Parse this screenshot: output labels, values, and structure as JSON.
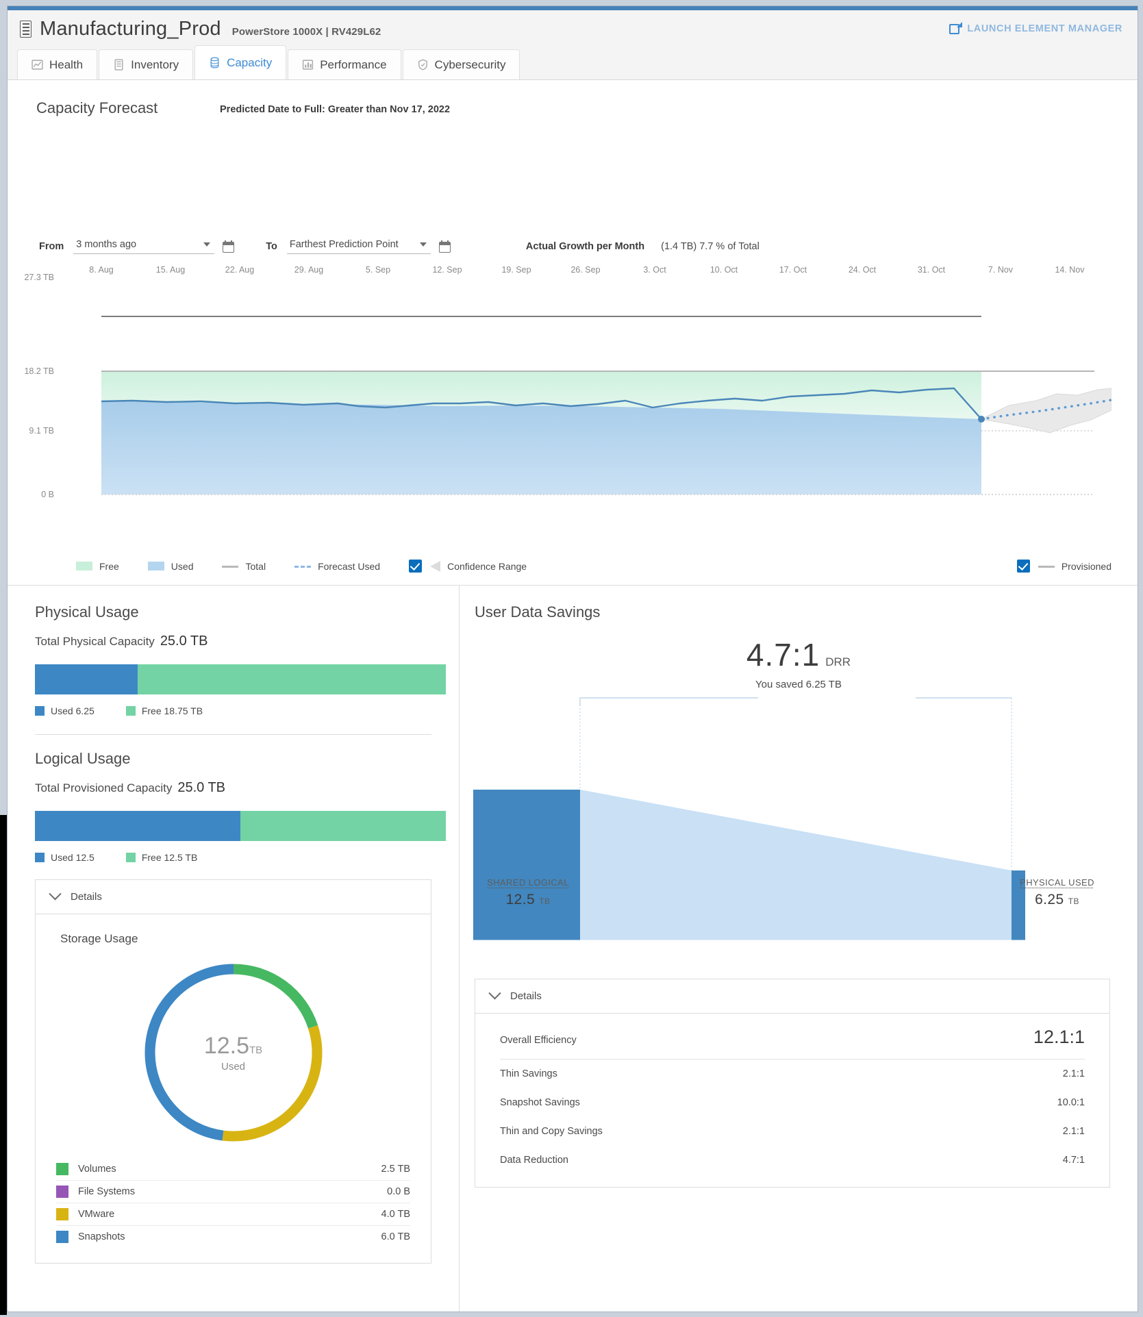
{
  "header": {
    "system_name": "Manufacturing_Prod",
    "system_model": "PowerStore 1000X | RV429L62",
    "launch_label": "LAUNCH ELEMENT MANAGER",
    "system_icon": "storage-array-icon",
    "launch_icon": "external-link-icon"
  },
  "tabs": [
    {
      "label": "Health",
      "icon": "health-chart-icon",
      "active": false
    },
    {
      "label": "Inventory",
      "icon": "inventory-rack-icon",
      "active": false
    },
    {
      "label": "Capacity",
      "icon": "capacity-database-icon",
      "active": true
    },
    {
      "label": "Performance",
      "icon": "performance-bars-icon",
      "active": false
    },
    {
      "label": "Cybersecurity",
      "icon": "shield-icon",
      "active": false
    }
  ],
  "forecast": {
    "title": "Capacity Forecast",
    "predicted": "Predicted Date to Full: Greater than Nov 17, 2022",
    "from_label": "From",
    "from_value": "3 months ago",
    "to_label": "To",
    "to_value": "Farthest Prediction Point",
    "growth_label": "Actual Growth per Month",
    "growth_value": "(1.4 TB) 7.7 % of Total",
    "legend": [
      {
        "label": "Free",
        "type": "swatch-free"
      },
      {
        "label": "Used",
        "type": "swatch-used"
      },
      {
        "label": "Total",
        "type": "line-total"
      },
      {
        "label": "Forecast Used",
        "type": "line-forecast"
      },
      {
        "label": "Confidence Range",
        "type": "checkbox-area",
        "checked": true
      }
    ],
    "legend_right": {
      "label": "Provisioned",
      "checked": true
    }
  },
  "chart_data": {
    "type": "area",
    "title": "Capacity Forecast",
    "xlabel": "",
    "ylabel": "",
    "grid": true,
    "legend_position": "bottom",
    "ylim": [
      0,
      27.3
    ],
    "yunit": "TB",
    "ytick_labels": [
      "27.3 TB",
      "18.2 TB",
      "9.1 TB",
      "0 B"
    ],
    "ytick_values": [
      27.3,
      18.2,
      9.1,
      0
    ],
    "xtick_labels": [
      "8. Aug",
      "15. Aug",
      "22. Aug",
      "29. Aug",
      "5. Sep",
      "12. Sep",
      "19. Sep",
      "26. Sep",
      "3. Oct",
      "10. Oct",
      "17. Oct",
      "24. Oct",
      "31. Oct",
      "7. Nov",
      "14. Nov"
    ],
    "series": [
      {
        "name": "Total",
        "type": "line",
        "color": "#9a9a9a",
        "values": [
          25.0,
          25.0,
          25.0,
          25.0,
          25.0,
          25.0,
          25.0,
          25.0,
          25.0,
          25.0,
          25.0,
          25.0,
          25.0
        ]
      },
      {
        "name": "Provisioned",
        "type": "line",
        "color": "#9a9a9a",
        "values": [
          18.2,
          18.2,
          18.2,
          18.2,
          18.2,
          18.2,
          18.2,
          18.2,
          18.2,
          18.2,
          18.2,
          18.2,
          18.2
        ]
      },
      {
        "name": "Free",
        "type": "area",
        "color": "#c8efd9",
        "values": [
          9.2,
          9.1,
          9.1,
          9.0,
          9.0,
          9.0,
          8.9,
          8.8,
          8.6,
          8.5,
          8.4,
          8.2,
          8.0
        ]
      },
      {
        "name": "Used",
        "type": "area",
        "color": "#aed0ea",
        "values": [
          8.9,
          9.0,
          9.0,
          9.1,
          9.1,
          9.1,
          9.3,
          9.4,
          9.6,
          9.7,
          9.8,
          10.0,
          10.2
        ]
      },
      {
        "name": "Forecast Used",
        "type": "dotted-line",
        "color": "#5b9bd5",
        "values": [
          10.2,
          10.5,
          10.8,
          11.1,
          11.4,
          11.7
        ]
      },
      {
        "name": "Confidence Range",
        "type": "band",
        "color": "#e6e6e6",
        "lower": [
          10.2,
          10.0,
          10.1,
          9.9,
          10.3,
          10.4
        ],
        "upper": [
          10.2,
          11.0,
          11.6,
          11.9,
          12.6,
          13.1
        ]
      }
    ]
  },
  "physical_usage": {
    "title": "Physical Usage",
    "total_label": "Total Physical Capacity",
    "total_value": "25.0 TB",
    "used_label": "Used 6.25",
    "free_label": "Free 18.75 TB",
    "used_pct": 25,
    "used_color": "#3d87c4",
    "free_color": "#73d3a4"
  },
  "logical_usage": {
    "title": "Logical Usage",
    "total_label": "Total Provisioned Capacity",
    "total_value": "25.0 TB",
    "used_label": "Used 12.5",
    "free_label": "Free 12.5 TB",
    "used_pct": 50,
    "used_color": "#3d87c4",
    "free_color": "#73d3a4",
    "details_label": "Details",
    "storage_usage": {
      "title": "Storage Usage",
      "center_value": "12.5",
      "center_unit": "TB",
      "center_sub": "Used",
      "items": [
        {
          "label": "Volumes",
          "value": "2.5 TB",
          "color": "#46b862",
          "pct": 20
        },
        {
          "label": "File Systems",
          "value": "0.0 B",
          "color": "#9656b5",
          "pct": 0
        },
        {
          "label": "VMware",
          "value": "4.0 TB",
          "color": "#d8b413",
          "pct": 32
        },
        {
          "label": "Snapshots",
          "value": "6.0 TB",
          "color": "#3d87c4",
          "pct": 48
        }
      ]
    }
  },
  "user_data_savings": {
    "title": "User Data Savings",
    "drr_value": "4.7:1",
    "drr_unit": "DRR",
    "saved_text": "You saved 6.25 TB",
    "left_label": "SHARED LOGICAL",
    "left_value": "12.5",
    "left_unit": "TB",
    "right_label": "PHYSICAL USED",
    "right_value": "6.25",
    "right_unit": "TB",
    "details_label": "Details",
    "rows": [
      {
        "label": "Overall Efficiency",
        "value": "12.1:1"
      },
      {
        "label": "Thin Savings",
        "value": "2.1:1"
      },
      {
        "label": "Snapshot Savings",
        "value": "10.0:1"
      },
      {
        "label": "Thin and Copy Savings",
        "value": "2.1:1"
      },
      {
        "label": "Data Reduction",
        "value": "4.7:1"
      }
    ]
  }
}
